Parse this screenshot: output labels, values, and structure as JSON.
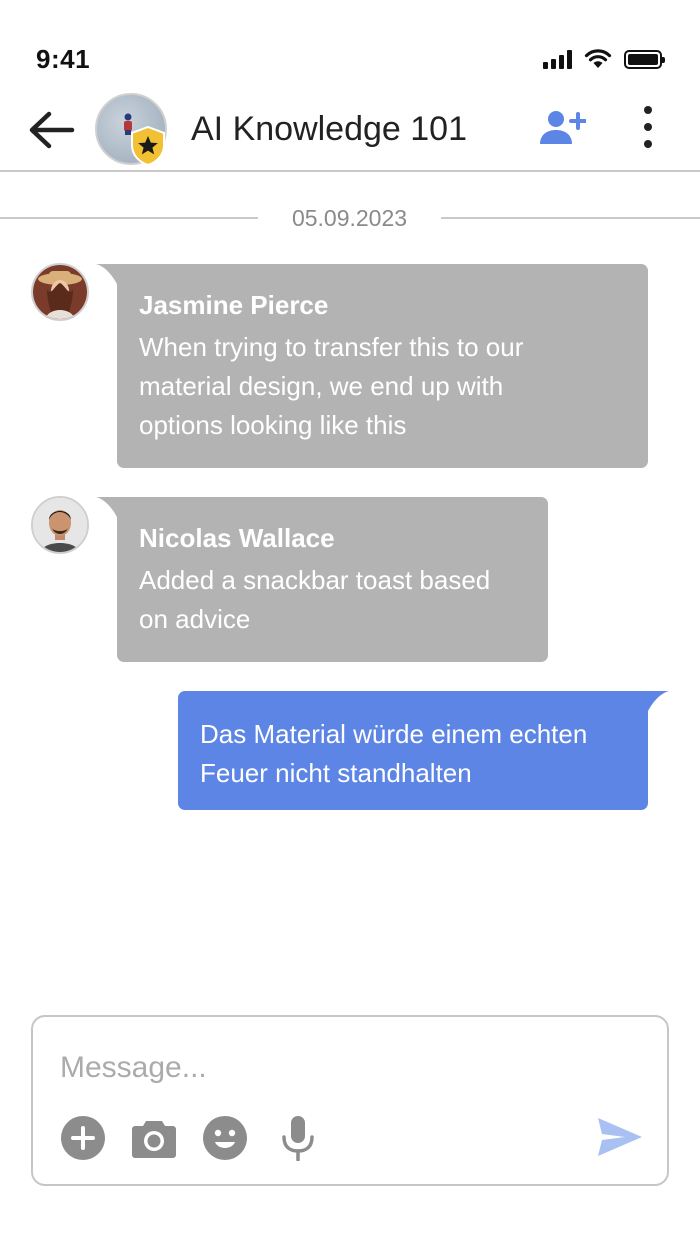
{
  "status_bar": {
    "time": "9:41",
    "icons": [
      "signal-icon",
      "wifi-icon",
      "battery-icon"
    ]
  },
  "header": {
    "title": "AI Knowledge 101",
    "icons": [
      "back-arrow-icon",
      "group-avatar",
      "admin-star-badge-icon",
      "add-user-icon",
      "more-vertical-icon"
    ]
  },
  "date_separator": "05.09.2023",
  "messages": [
    {
      "direction": "incoming",
      "sender": "Jasmine Pierce",
      "lines": [
        "When trying to transfer this to our",
        "material design, we end up with",
        "options looking like this"
      ]
    },
    {
      "direction": "incoming",
      "sender": "Nicolas Wallace",
      "lines": [
        "Added a snackbar toast based",
        "on advice"
      ]
    },
    {
      "direction": "outgoing",
      "lines": [
        "Das Material würde einem echten",
        "Feuer nicht standhalten"
      ]
    }
  ],
  "composer": {
    "placeholder": "Message...",
    "value": "",
    "tools": [
      "add-icon",
      "camera-icon",
      "emoji-icon",
      "microphone-icon"
    ],
    "send": "send-icon"
  },
  "colors": {
    "accent": "#5c85e5",
    "incoming_bubble": "#b3b3b3",
    "badge": "#f2c033",
    "icon_gray": "#8c8c8c",
    "send_icon": "#a9c0f2"
  }
}
